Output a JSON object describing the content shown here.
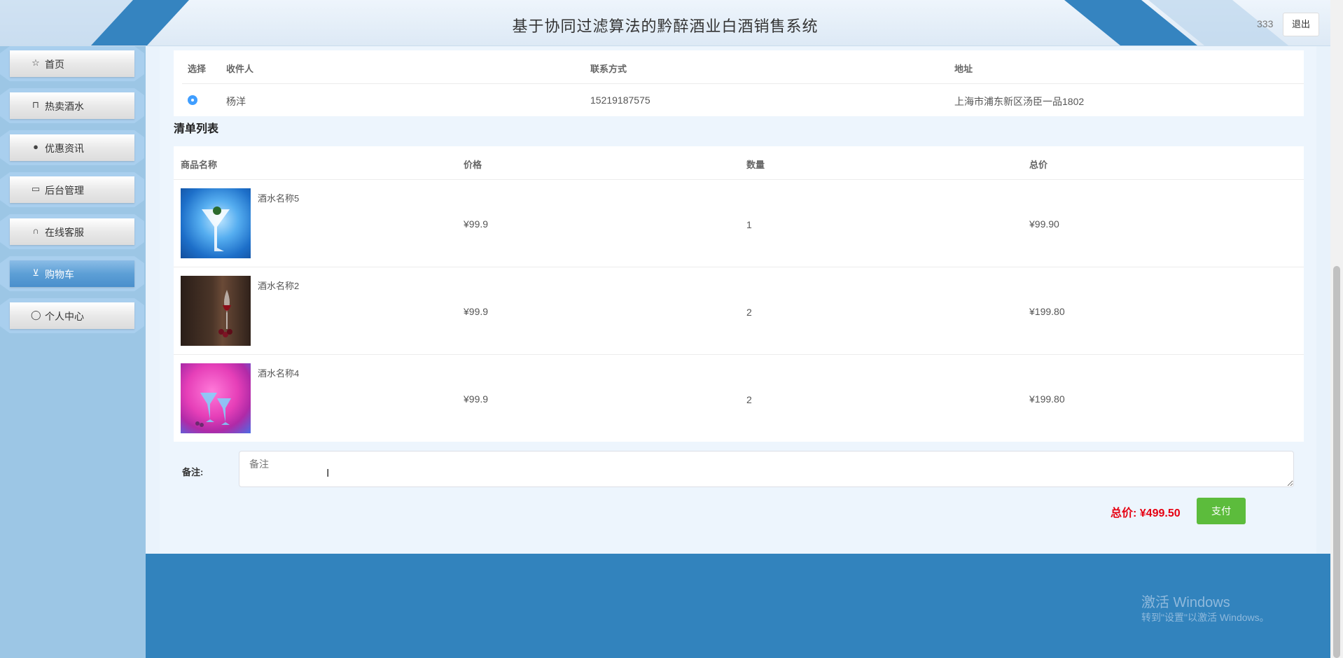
{
  "header": {
    "title": "基于协同过滤算法的黔醉酒业白酒销售系统",
    "username": "333",
    "logout_label": "退出"
  },
  "sidebar": {
    "items": [
      {
        "label": "首页",
        "icon": "star-icon",
        "glyph": "☆"
      },
      {
        "label": "热卖酒水",
        "icon": "bag-icon",
        "glyph": "⊓"
      },
      {
        "label": "优惠资讯",
        "icon": "info-icon",
        "glyph": "●"
      },
      {
        "label": "后台管理",
        "icon": "calendar-icon",
        "glyph": "▭"
      },
      {
        "label": "在线客服",
        "icon": "headset-icon",
        "glyph": "∩"
      },
      {
        "label": "购物车",
        "icon": "cart-icon",
        "glyph": "⊻"
      },
      {
        "label": "个人中心",
        "icon": "user-icon",
        "glyph": "◯"
      }
    ],
    "active_index": 5
  },
  "address_table": {
    "headers": [
      "选择",
      "收件人",
      "联系方式",
      "地址"
    ],
    "rows": [
      {
        "recipient": "杨洋",
        "phone": "15219187575",
        "address": "上海市浦东新区汤臣一品1802"
      }
    ]
  },
  "order_list": {
    "title": "清单列表",
    "headers": [
      "商品名称",
      "价格",
      "数量",
      "总价"
    ],
    "rows": [
      {
        "name": "酒水名称5",
        "price": "¥99.9",
        "quantity": "1",
        "total": "¥99.90"
      },
      {
        "name": "酒水名称2",
        "price": "¥99.9",
        "quantity": "2",
        "total": "¥199.80"
      },
      {
        "name": "酒水名称4",
        "price": "¥99.9",
        "quantity": "2",
        "total": "¥199.80"
      }
    ]
  },
  "remark": {
    "label": "备注:",
    "placeholder": "备注"
  },
  "summary": {
    "total_text": "总价: ¥499.50",
    "pay_label": "支付"
  },
  "windows_watermark": {
    "title": "激活 Windows",
    "subtitle": "转到\"设置\"以激活 Windows。"
  },
  "colors": {
    "accent": "#3283bd",
    "price_red": "#e60012",
    "pay_green": "#5cbc3c",
    "radio_blue": "#409eff"
  }
}
